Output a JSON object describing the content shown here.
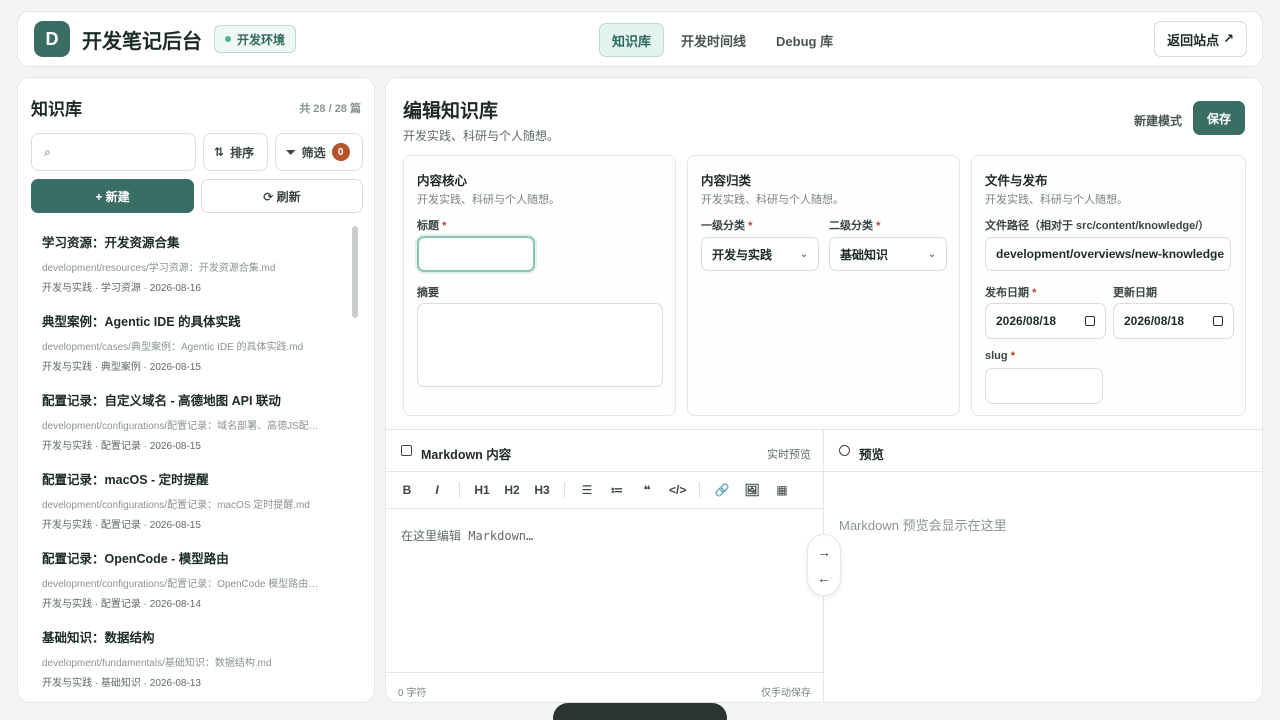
{
  "header": {
    "logo_letter": "D",
    "title": "开发笔记后台",
    "env_badge": "开发环境",
    "tabs": [
      {
        "label": "知识库",
        "active": true
      },
      {
        "label": "开发时间线",
        "active": false
      },
      {
        "label": "Debug 库",
        "active": false
      }
    ],
    "back_label": "返回站点",
    "back_icon": "↗"
  },
  "sidebar": {
    "title": "知识库",
    "count": "共 28 / 28 篇",
    "search_icon": "⌕",
    "sort_icon": "⇅",
    "sort_label": "排序",
    "filter_icon": "⏷",
    "filter_label": "筛选",
    "filter_count": "0",
    "new_label": "+ 新建",
    "refresh_label": "⟳ 刷新",
    "items": [
      {
        "title": "学习资源：开发资源合集",
        "path": "development/resources/学习资源：开发资源合集.md",
        "meta": "开发与实践 · 学习资源 · 2026-08-16"
      },
      {
        "title": "典型案例：Agentic IDE 的具体实践",
        "path": "development/cases/典型案例：Agentic IDE 的具体实践.md",
        "meta": "开发与实践 · 典型案例 · 2026-08-15"
      },
      {
        "title": "配置记录：自定义域名 - 高德地图 API 联动",
        "path": "development/configurations/配置记录：域名部署、高德JS配…",
        "meta": "开发与实践 · 配置记录 · 2026-08-15"
      },
      {
        "title": "配置记录：macOS - 定时提醒",
        "path": "development/configurations/配置记录：macOS 定时提醒.md",
        "meta": "开发与实践 · 配置记录 · 2026-08-15"
      },
      {
        "title": "配置记录：OpenCode - 模型路由",
        "path": "development/configurations/配置记录：OpenCode 模型路由…",
        "meta": "开发与实践 · 配置记录 · 2026-08-14"
      },
      {
        "title": "基础知识：数据结构",
        "path": "development/fundamentals/基础知识：数据结构.md",
        "meta": "开发与实践 · 基础知识 · 2026-08-13"
      }
    ]
  },
  "editor_header": {
    "title": "编辑知识库",
    "subtitle": "开发实践、科研与个人随想。",
    "mode_label": "新建模式",
    "save_label": "保存"
  },
  "cards": {
    "core": {
      "title": "内容核心",
      "subtitle": "开发实践、科研与个人随想。",
      "title_label": "标题",
      "summary_label": "摘要"
    },
    "category": {
      "title": "内容归类",
      "subtitle": "开发实践、科研与个人随想。",
      "level1_label": "一级分类",
      "level1_value": "开发与实践",
      "level2_label": "二级分类",
      "level2_value": "基础知识"
    },
    "file": {
      "title": "文件与发布",
      "subtitle": "开发实践、科研与个人随想。",
      "path_label": "文件路径（相对于 src/content/knowledge/）",
      "path_value": "development/overviews/new-knowledge",
      "publish_label": "发布日期",
      "publish_value": "2026/08/18",
      "update_label": "更新日期",
      "update_value": "2026/08/18",
      "slug_label": "slug"
    },
    "required_mark": "*"
  },
  "markdown": {
    "title": "Markdown 内容",
    "live_label": "实时预览",
    "toolbar": [
      "B",
      "I",
      "H1",
      "H2",
      "H3",
      "☰",
      "≔",
      "❝",
      "</>",
      "🔗",
      "🖼",
      "▦"
    ],
    "placeholder": "在这里编辑 Markdown…",
    "char_count": "0 字符",
    "save_mode": "仅手动保存"
  },
  "preview": {
    "title": "预览",
    "placeholder": "Markdown 预览会显示在这里"
  },
  "float_arrows": {
    "right": "→",
    "left": "←"
  }
}
